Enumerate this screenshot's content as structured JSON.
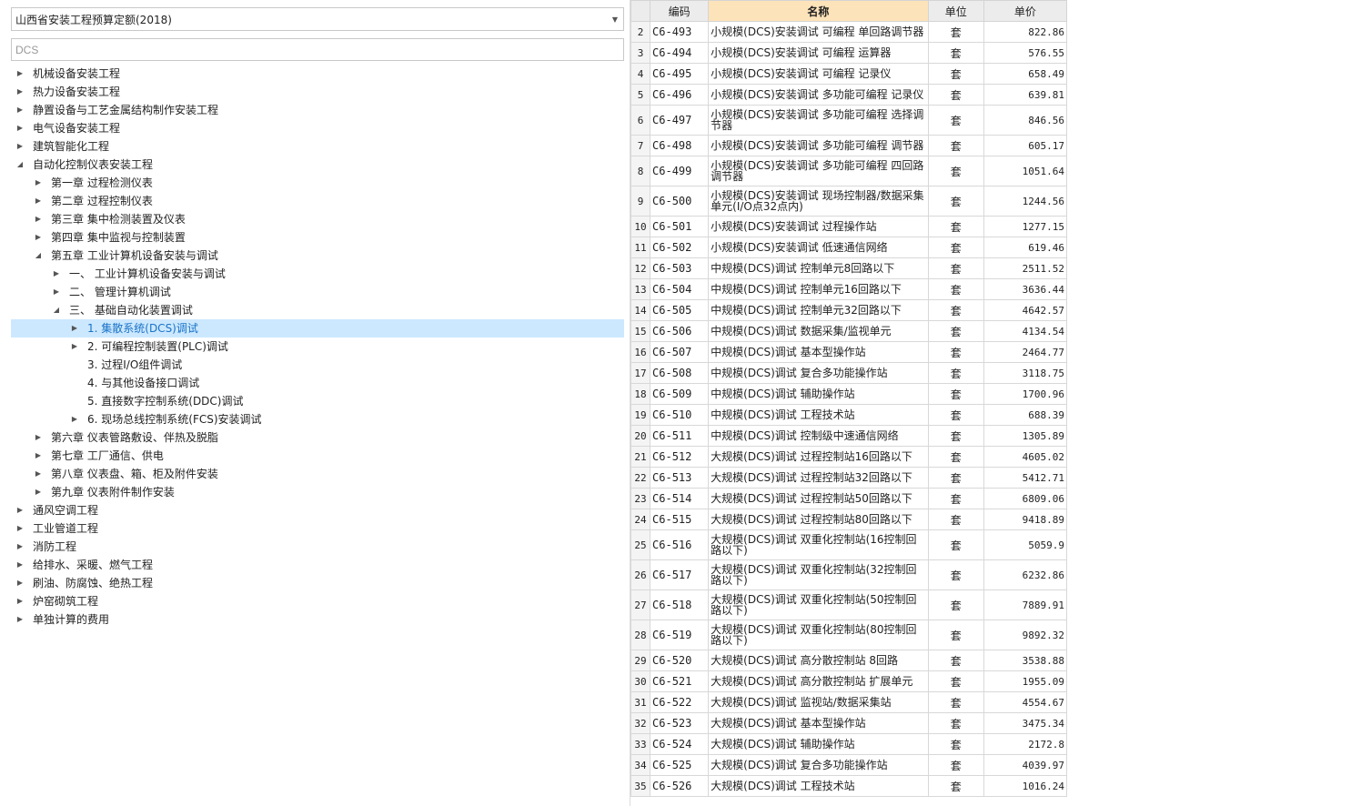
{
  "library": {
    "selected": "山西省安装工程预算定额(2018)"
  },
  "search": {
    "value": "DCS"
  },
  "tree": [
    {
      "label": "机械设备安装工程",
      "level": 0,
      "toggle": "collapsed"
    },
    {
      "label": "热力设备安装工程",
      "level": 0,
      "toggle": "collapsed"
    },
    {
      "label": "静置设备与工艺金属结构制作安装工程",
      "level": 0,
      "toggle": "collapsed"
    },
    {
      "label": "电气设备安装工程",
      "level": 0,
      "toggle": "collapsed"
    },
    {
      "label": "建筑智能化工程",
      "level": 0,
      "toggle": "collapsed"
    },
    {
      "label": "自动化控制仪表安装工程",
      "level": 0,
      "toggle": "expanded"
    },
    {
      "label": "第一章 过程检测仪表",
      "level": 1,
      "toggle": "collapsed"
    },
    {
      "label": "第二章 过程控制仪表",
      "level": 1,
      "toggle": "collapsed"
    },
    {
      "label": "第三章 集中检测装置及仪表",
      "level": 1,
      "toggle": "collapsed"
    },
    {
      "label": "第四章 集中监视与控制装置",
      "level": 1,
      "toggle": "collapsed"
    },
    {
      "label": "第五章 工业计算机设备安装与调试",
      "level": 1,
      "toggle": "expanded"
    },
    {
      "label": "一、 工业计算机设备安装与调试",
      "level": 2,
      "toggle": "collapsed"
    },
    {
      "label": "二、 管理计算机调试",
      "level": 2,
      "toggle": "collapsed"
    },
    {
      "label": "三、 基础自动化装置调试",
      "level": 2,
      "toggle": "expanded"
    },
    {
      "label": "1. 集散系统(DCS)调试",
      "level": 3,
      "toggle": "collapsed",
      "selected": true
    },
    {
      "label": "2. 可编程控制装置(PLC)调试",
      "level": 3,
      "toggle": "collapsed"
    },
    {
      "label": "3. 过程I/O组件调试",
      "level": 3,
      "toggle": "none"
    },
    {
      "label": "4. 与其他设备接口调试",
      "level": 3,
      "toggle": "none"
    },
    {
      "label": "5. 直接数字控制系统(DDC)调试",
      "level": 3,
      "toggle": "none"
    },
    {
      "label": "6. 现场总线控制系统(FCS)安装调试",
      "level": 3,
      "toggle": "collapsed"
    },
    {
      "label": "第六章 仪表管路敷设、伴热及脱脂",
      "level": 1,
      "toggle": "collapsed"
    },
    {
      "label": "第七章 工厂通信、供电",
      "level": 1,
      "toggle": "collapsed"
    },
    {
      "label": "第八章 仪表盘、箱、柜及附件安装",
      "level": 1,
      "toggle": "collapsed"
    },
    {
      "label": "第九章 仪表附件制作安装",
      "level": 1,
      "toggle": "collapsed"
    },
    {
      "label": "通风空调工程",
      "level": 0,
      "toggle": "collapsed"
    },
    {
      "label": "工业管道工程",
      "level": 0,
      "toggle": "collapsed"
    },
    {
      "label": "消防工程",
      "level": 0,
      "toggle": "collapsed"
    },
    {
      "label": "给排水、采暖、燃气工程",
      "level": 0,
      "toggle": "collapsed"
    },
    {
      "label": "刷油、防腐蚀、绝热工程",
      "level": 0,
      "toggle": "collapsed"
    },
    {
      "label": "炉窑砌筑工程",
      "level": 0,
      "toggle": "collapsed"
    },
    {
      "label": "单独计算的费用",
      "level": 0,
      "toggle": "collapsed"
    }
  ],
  "icons": {
    "collapsed": "triangle-right-icon",
    "expanded": "triangle-down-icon"
  },
  "colors": {
    "selected_bg": "#cce8ff",
    "name_header_bg": "#fde3b9"
  },
  "table": {
    "headers": {
      "code": "编码",
      "name": "名称",
      "unit": "单位",
      "price": "单价"
    },
    "rows": [
      {
        "n": "2",
        "code": "C6-493",
        "name": "小规模(DCS)安装调试 可编程 单回路调节器",
        "unit": "套",
        "price": "822.86"
      },
      {
        "n": "3",
        "code": "C6-494",
        "name": "小规模(DCS)安装调试 可编程 运算器",
        "unit": "套",
        "price": "576.55"
      },
      {
        "n": "4",
        "code": "C6-495",
        "name": "小规模(DCS)安装调试 可编程 记录仪",
        "unit": "套",
        "price": "658.49"
      },
      {
        "n": "5",
        "code": "C6-496",
        "name": "小规模(DCS)安装调试 多功能可编程 记录仪",
        "unit": "套",
        "price": "639.81"
      },
      {
        "n": "6",
        "code": "C6-497",
        "name": "小规模(DCS)安装调试 多功能可编程 选择调节器",
        "unit": "套",
        "price": "846.56",
        "tall": true
      },
      {
        "n": "7",
        "code": "C6-498",
        "name": "小规模(DCS)安装调试 多功能可编程 调节器",
        "unit": "套",
        "price": "605.17"
      },
      {
        "n": "8",
        "code": "C6-499",
        "name": "小规模(DCS)安装调试 多功能可编程 四回路调节器",
        "unit": "套",
        "price": "1051.64",
        "tall": true
      },
      {
        "n": "9",
        "code": "C6-500",
        "name": "小规模(DCS)安装调试 现场控制器/数据采集单元(I/O点32点内)",
        "unit": "套",
        "price": "1244.56",
        "tall": true
      },
      {
        "n": "10",
        "code": "C6-501",
        "name": "小规模(DCS)安装调试 过程操作站",
        "unit": "套",
        "price": "1277.15"
      },
      {
        "n": "11",
        "code": "C6-502",
        "name": "小规模(DCS)安装调试 低速通信网络",
        "unit": "套",
        "price": "619.46"
      },
      {
        "n": "12",
        "code": "C6-503",
        "name": "中规模(DCS)调试 控制单元8回路以下",
        "unit": "套",
        "price": "2511.52"
      },
      {
        "n": "13",
        "code": "C6-504",
        "name": "中规模(DCS)调试 控制单元16回路以下",
        "unit": "套",
        "price": "3636.44"
      },
      {
        "n": "14",
        "code": "C6-505",
        "name": "中规模(DCS)调试 控制单元32回路以下",
        "unit": "套",
        "price": "4642.57"
      },
      {
        "n": "15",
        "code": "C6-506",
        "name": "中规模(DCS)调试 数据采集/监视单元",
        "unit": "套",
        "price": "4134.54"
      },
      {
        "n": "16",
        "code": "C6-507",
        "name": "中规模(DCS)调试 基本型操作站",
        "unit": "套",
        "price": "2464.77"
      },
      {
        "n": "17",
        "code": "C6-508",
        "name": "中规模(DCS)调试 复合多功能操作站",
        "unit": "套",
        "price": "3118.75"
      },
      {
        "n": "18",
        "code": "C6-509",
        "name": "中规模(DCS)调试 辅助操作站",
        "unit": "套",
        "price": "1700.96"
      },
      {
        "n": "19",
        "code": "C6-510",
        "name": "中规模(DCS)调试 工程技术站",
        "unit": "套",
        "price": "688.39"
      },
      {
        "n": "20",
        "code": "C6-511",
        "name": "中规模(DCS)调试 控制级中速通信网络",
        "unit": "套",
        "price": "1305.89"
      },
      {
        "n": "21",
        "code": "C6-512",
        "name": "大规模(DCS)调试 过程控制站16回路以下",
        "unit": "套",
        "price": "4605.02"
      },
      {
        "n": "22",
        "code": "C6-513",
        "name": "大规模(DCS)调试 过程控制站32回路以下",
        "unit": "套",
        "price": "5412.71"
      },
      {
        "n": "23",
        "code": "C6-514",
        "name": "大规模(DCS)调试 过程控制站50回路以下",
        "unit": "套",
        "price": "6809.06"
      },
      {
        "n": "24",
        "code": "C6-515",
        "name": "大规模(DCS)调试 过程控制站80回路以下",
        "unit": "套",
        "price": "9418.89"
      },
      {
        "n": "25",
        "code": "C6-516",
        "name": "大规模(DCS)调试 双重化控制站(16控制回路以下)",
        "unit": "套",
        "price": "5059.9",
        "tall": true
      },
      {
        "n": "26",
        "code": "C6-517",
        "name": "大规模(DCS)调试 双重化控制站(32控制回路以下)",
        "unit": "套",
        "price": "6232.86",
        "tall": true
      },
      {
        "n": "27",
        "code": "C6-518",
        "name": "大规模(DCS)调试 双重化控制站(50控制回路以下)",
        "unit": "套",
        "price": "7889.91",
        "tall": true
      },
      {
        "n": "28",
        "code": "C6-519",
        "name": "大规模(DCS)调试 双重化控制站(80控制回路以下)",
        "unit": "套",
        "price": "9892.32",
        "tall": true
      },
      {
        "n": "29",
        "code": "C6-520",
        "name": "大规模(DCS)调试 高分散控制站 8回路",
        "unit": "套",
        "price": "3538.88"
      },
      {
        "n": "30",
        "code": "C6-521",
        "name": "大规模(DCS)调试 高分散控制站 扩展单元",
        "unit": "套",
        "price": "1955.09"
      },
      {
        "n": "31",
        "code": "C6-522",
        "name": "大规模(DCS)调试 监视站/数据采集站",
        "unit": "套",
        "price": "4554.67"
      },
      {
        "n": "32",
        "code": "C6-523",
        "name": "大规模(DCS)调试 基本型操作站",
        "unit": "套",
        "price": "3475.34"
      },
      {
        "n": "33",
        "code": "C6-524",
        "name": "大规模(DCS)调试 辅助操作站",
        "unit": "套",
        "price": "2172.8"
      },
      {
        "n": "34",
        "code": "C6-525",
        "name": "大规模(DCS)调试 复合多功能操作站",
        "unit": "套",
        "price": "4039.97"
      },
      {
        "n": "35",
        "code": "C6-526",
        "name": "大规模(DCS)调试 工程技术站",
        "unit": "套",
        "price": "1016.24"
      }
    ]
  }
}
